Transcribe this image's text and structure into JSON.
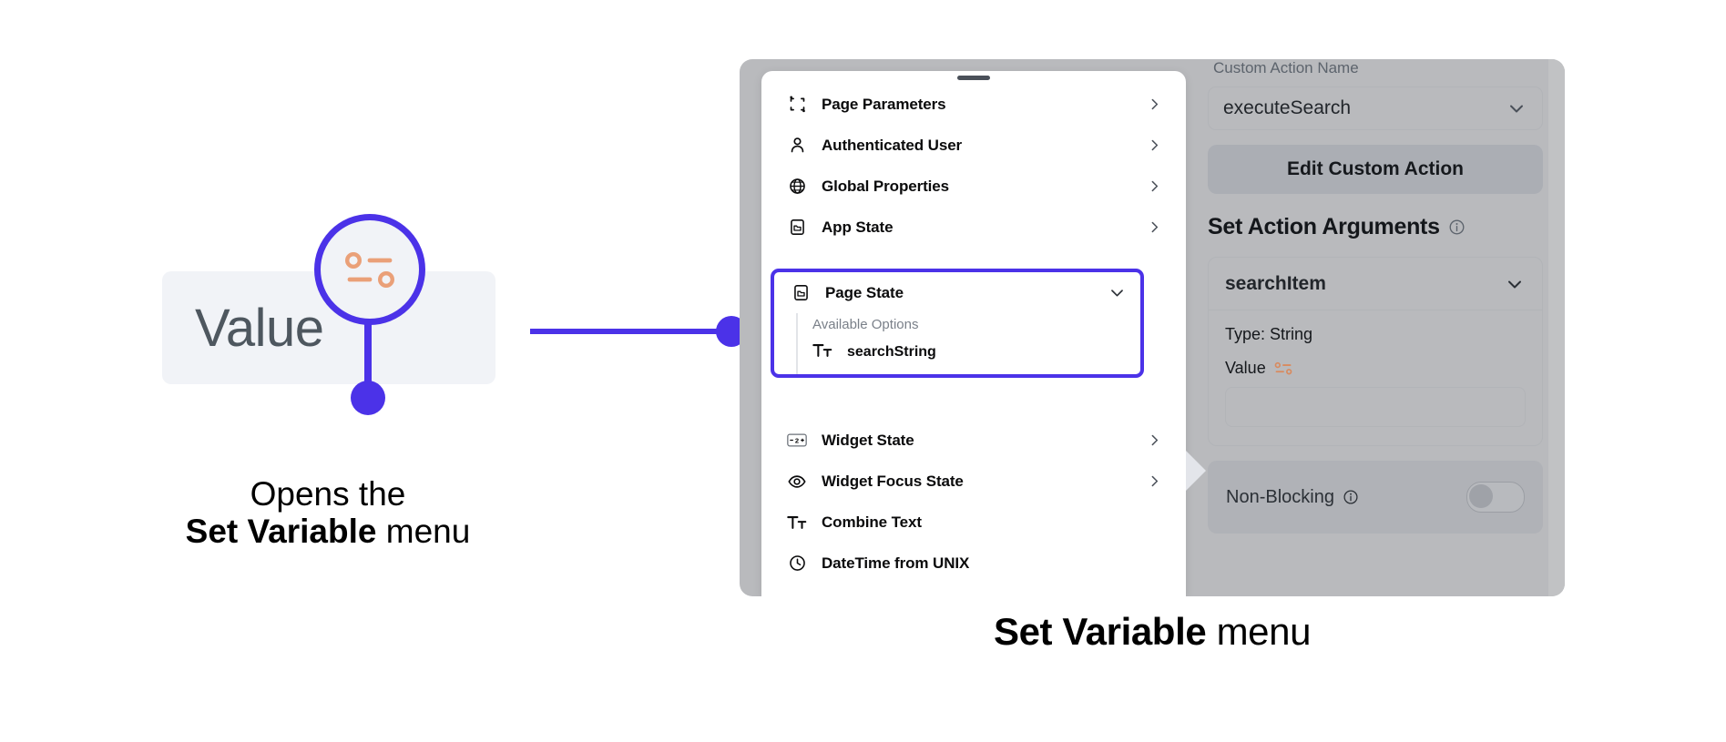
{
  "colors": {
    "accent_purple": "#4b32e8",
    "panel_gray": "#b9babd",
    "chip_gray": "#f1f3f7",
    "icon_orange": "#eaa078"
  },
  "callout": {
    "value_chip_label": "Value",
    "magnifier_icon": "set-variable-icon",
    "caption_line1": "Opens the",
    "caption_bold": "Set Variable",
    "caption_after": " menu"
  },
  "bottom_caption": {
    "bold": "Set Variable",
    "rest": " menu"
  },
  "menu": {
    "drag_handle": "drag-handle",
    "items": [
      {
        "label": "Page Parameters",
        "icon": "page-parameters-icon",
        "chevron": "chevron-right"
      },
      {
        "label": "Authenticated User",
        "icon": "user-icon",
        "chevron": "chevron-right"
      },
      {
        "label": "Global Properties",
        "icon": "globe-icon",
        "chevron": "chevron-right"
      },
      {
        "label": "App State",
        "icon": "app-state-icon",
        "chevron": "chevron-right"
      },
      {
        "label": "Widget State",
        "icon": "widget-state-icon",
        "chevron": "chevron-right"
      },
      {
        "label": "Widget Focus State",
        "icon": "eye-icon",
        "chevron": "chevron-right"
      },
      {
        "label": "Combine Text",
        "icon": "text-format-icon",
        "chevron": ""
      },
      {
        "label": "DateTime from UNIX",
        "icon": "clock-icon",
        "chevron": ""
      }
    ],
    "page_state": {
      "label": "Page State",
      "icon": "page-state-icon",
      "chevron": "chevron-down",
      "available_options_label": "Available Options",
      "options": [
        {
          "label": "searchString",
          "icon": "text-format-icon"
        }
      ]
    }
  },
  "properties": {
    "custom_action_name_label": "Custom Action Name",
    "custom_action_name_value": "executeSearch",
    "edit_custom_action_label": "Edit Custom Action",
    "set_action_arguments_label": "Set Action Arguments",
    "argument_name": "searchItem",
    "argument_type": "Type: String",
    "argument_value_label": "Value",
    "argument_value": "",
    "non_blocking_label": "Non-Blocking",
    "non_blocking_state": "off"
  }
}
